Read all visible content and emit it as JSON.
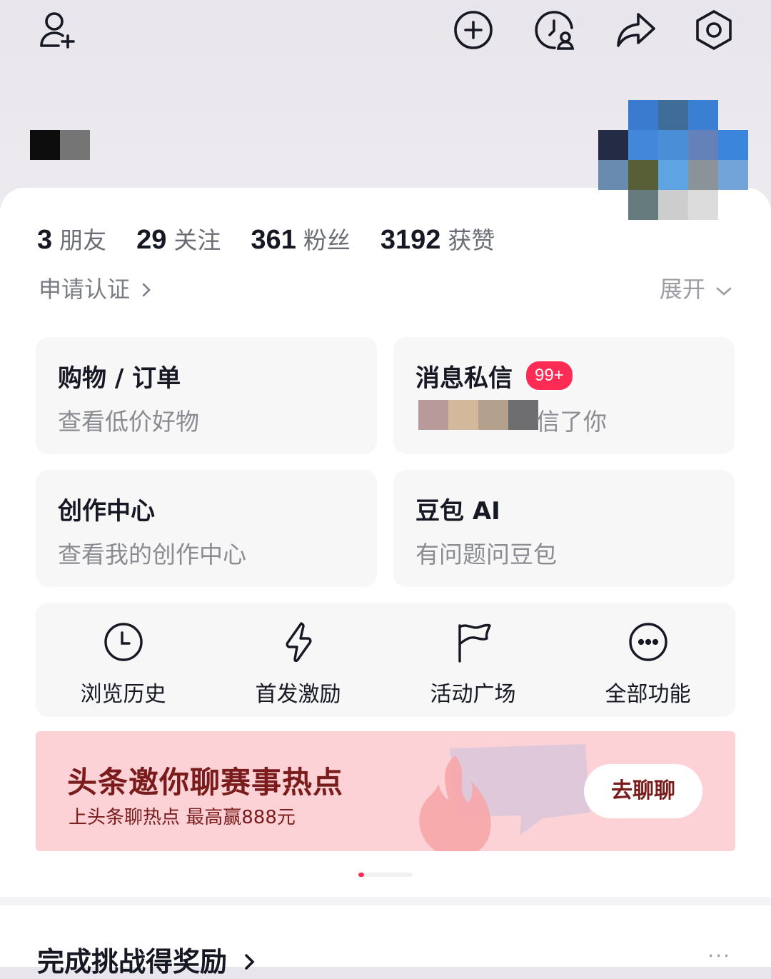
{
  "top_icons": [
    "add-friend-icon",
    "add-circle-icon",
    "visitor-icon",
    "share-icon",
    "settings-icon"
  ],
  "stats": [
    {
      "num": "3",
      "label": "朋友"
    },
    {
      "num": "29",
      "label": "关注"
    },
    {
      "num": "361",
      "label": "粉丝"
    },
    {
      "num": "3192",
      "label": "获赞"
    }
  ],
  "apply_cert": "申请认证",
  "expand": "展开",
  "cards": {
    "shopping": {
      "title": "购物 / 订单",
      "subtitle": "查看低价好物"
    },
    "messages": {
      "title": "消息私信",
      "badge": "99+",
      "subtitle": "信了你"
    },
    "creator": {
      "title": "创作中心",
      "subtitle": "查看我的创作中心"
    },
    "doubao": {
      "title": "豆包 AI",
      "subtitle": "有问题问豆包"
    }
  },
  "quick_actions": [
    {
      "label": "浏览历史",
      "icon": "clock-icon"
    },
    {
      "label": "首发激励",
      "icon": "lightning-icon"
    },
    {
      "label": "活动广场",
      "icon": "flag-icon"
    },
    {
      "label": "全部功能",
      "icon": "more-circle-icon"
    }
  ],
  "banner": {
    "title": "头条邀你聊赛事热点",
    "subtitle": "上头条聊热点 最高赢888元",
    "button": "去聊聊"
  },
  "challenge": {
    "label": "完成挑战得奖励",
    "more": "···"
  },
  "colors": {
    "accent": "#fe2c55",
    "banner_bg": "#fdd2d6",
    "banner_text": "#7a1c1c"
  }
}
